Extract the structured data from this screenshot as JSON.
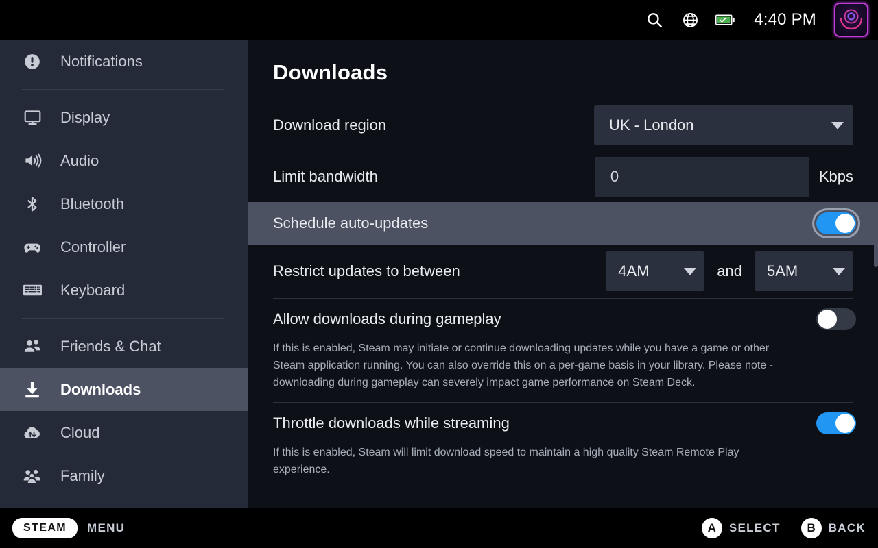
{
  "topbar": {
    "search_icon": "search-icon",
    "network_icon": "globe-icon",
    "battery_icon": "battery-charged-icon",
    "time": "4:40 PM",
    "avatar_icon": "user-avatar"
  },
  "sidebar": {
    "items": [
      {
        "label": "Notifications",
        "icon": "notification-icon",
        "active": false
      },
      {
        "label": "Display",
        "icon": "display-icon",
        "active": false
      },
      {
        "label": "Audio",
        "icon": "audio-icon",
        "active": false
      },
      {
        "label": "Bluetooth",
        "icon": "bluetooth-icon",
        "active": false
      },
      {
        "label": "Controller",
        "icon": "controller-icon",
        "active": false
      },
      {
        "label": "Keyboard",
        "icon": "keyboard-icon",
        "active": false
      },
      {
        "label": "Friends & Chat",
        "icon": "friends-icon",
        "active": false
      },
      {
        "label": "Downloads",
        "icon": "download-icon",
        "active": true
      },
      {
        "label": "Cloud",
        "icon": "cloud-sync-icon",
        "active": false
      },
      {
        "label": "Family",
        "icon": "family-icon",
        "active": false
      }
    ]
  },
  "main": {
    "title": "Downloads",
    "download_region": {
      "label": "Download region",
      "value": "UK - London"
    },
    "limit_bandwidth": {
      "label": "Limit bandwidth",
      "value": "0",
      "unit": "Kbps"
    },
    "schedule_auto_updates": {
      "label": "Schedule auto-updates",
      "enabled": true,
      "focused": true
    },
    "restrict_updates": {
      "label": "Restrict updates to between",
      "start_time": "4AM",
      "conjunction": "and",
      "end_time": "5AM"
    },
    "allow_downloads_gameplay": {
      "label": "Allow downloads during gameplay",
      "enabled": false,
      "description": "If this is enabled, Steam may initiate or continue downloading updates while you have a game or other Steam application running. You can also override this on a per-game basis in your library. Please note - downloading during gameplay can severely impact game performance on Steam Deck."
    },
    "throttle_streaming": {
      "label": "Throttle downloads while streaming",
      "enabled": true,
      "description": "If this is enabled, Steam will limit download speed to maintain a high quality Steam Remote Play experience."
    }
  },
  "bottombar": {
    "steam_pill": "STEAM",
    "menu_label": "MENU",
    "select_button": "A",
    "select_label": "SELECT",
    "back_button": "B",
    "back_label": "BACK"
  },
  "colors": {
    "accent_blue": "#2196f3",
    "sidebar_bg": "#242a38",
    "content_bg": "#0d1117",
    "highlight_bg": "#4d5263",
    "battery_green": "#4caf50"
  }
}
